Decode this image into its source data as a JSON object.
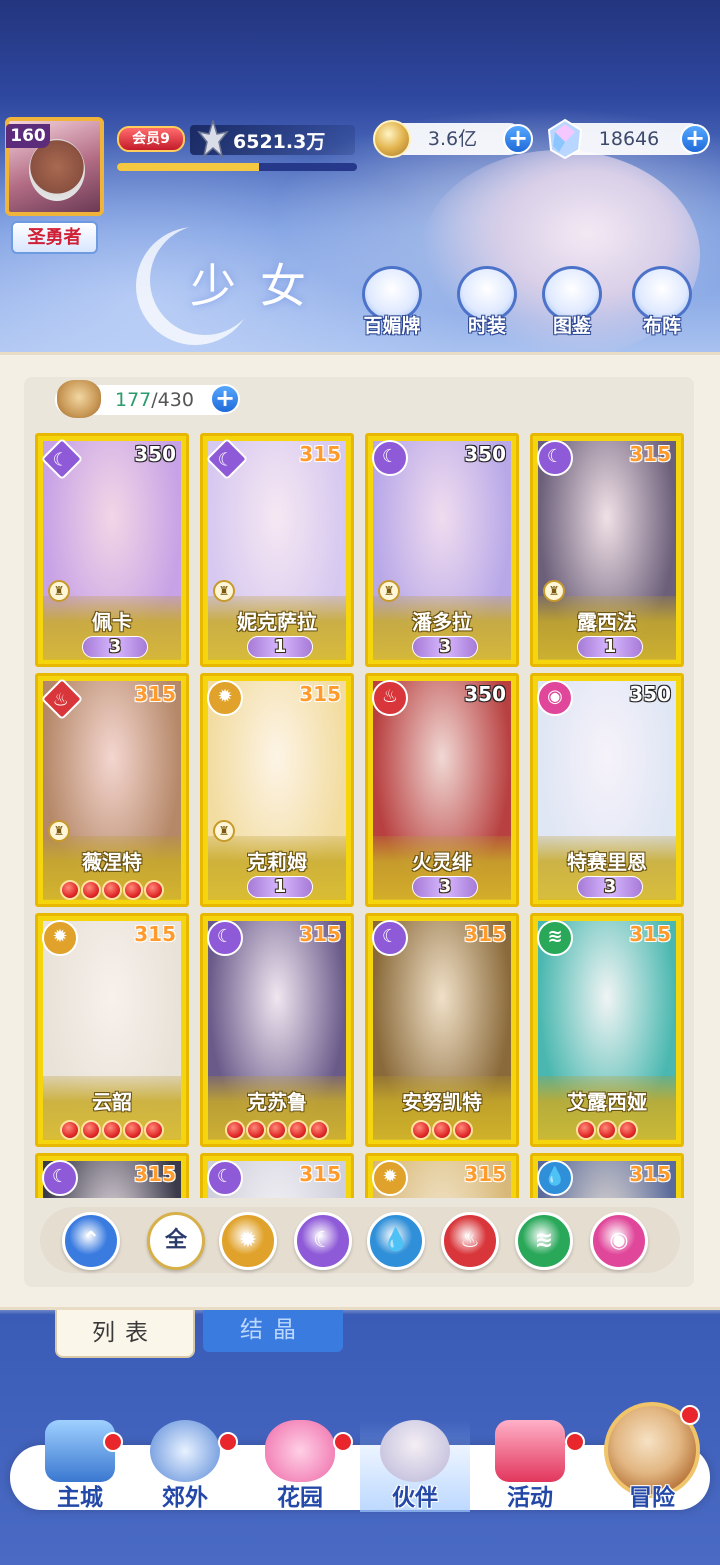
{
  "player": {
    "level": "160",
    "title": "圣勇者",
    "vip": "会员9",
    "power": "6521.3万",
    "exp_fraction": 0.59
  },
  "resources": {
    "gold": "3.6亿",
    "gems": "18646"
  },
  "page": {
    "title": "少女",
    "buttons": [
      "百媚牌",
      "时装",
      "图鉴",
      "布阵"
    ]
  },
  "roster": {
    "current": "177",
    "max": "/430"
  },
  "cards": [
    {
      "name": "佩卡",
      "level": "350",
      "element": "moon",
      "elem_shape": "diamond",
      "role": "rook",
      "wings": "3"
    },
    {
      "name": "妮克萨拉",
      "level": "315",
      "element": "moon",
      "elem_shape": "diamond",
      "role": "rook",
      "wings": "1"
    },
    {
      "name": "潘多拉",
      "level": "350",
      "element": "moon",
      "elem_shape": "circle",
      "role": "rook",
      "wings": "3"
    },
    {
      "name": "露西法",
      "level": "315",
      "element": "moon",
      "elem_shape": "circle",
      "role": "rook",
      "wings": "1"
    },
    {
      "name": "薇涅特",
      "level": "315",
      "element": "fire",
      "elem_shape": "diamond",
      "role": "rook",
      "stars": 5
    },
    {
      "name": "克莉姆",
      "level": "315",
      "element": "sun",
      "elem_shape": "circle",
      "role": "rook",
      "wings": "1"
    },
    {
      "name": "火灵绯",
      "level": "350",
      "element": "fire",
      "elem_shape": "circle",
      "wings": "3"
    },
    {
      "name": "特赛里恩",
      "level": "350",
      "element": "pink",
      "elem_shape": "circle",
      "wings": "3"
    },
    {
      "name": "云韶",
      "level": "315",
      "element": "sun",
      "elem_shape": "circle",
      "stars": 5
    },
    {
      "name": "克苏鲁",
      "level": "315",
      "element": "moon",
      "elem_shape": "circle",
      "stars": 5
    },
    {
      "name": "安努凯特",
      "level": "315",
      "element": "moon",
      "elem_shape": "circle",
      "stars": 3
    },
    {
      "name": "艾露西娅",
      "level": "315",
      "element": "wind",
      "elem_shape": "circle",
      "stars": 3
    },
    {
      "name": "",
      "level": "315",
      "element": "moon",
      "elem_shape": "circle"
    },
    {
      "name": "",
      "level": "315",
      "element": "moon",
      "elem_shape": "circle"
    },
    {
      "name": "",
      "level": "315",
      "element": "sun",
      "elem_shape": "circle"
    },
    {
      "name": "",
      "level": "315",
      "element": "water",
      "elem_shape": "circle"
    }
  ],
  "filters": {
    "all_label": "全",
    "items": [
      "sort",
      "all",
      "sun",
      "moon",
      "water",
      "fire",
      "wind",
      "pink"
    ]
  },
  "tabs": [
    "列表",
    "结晶"
  ],
  "nav": [
    "主城",
    "郊外",
    "花园",
    "伙伴",
    "活动",
    "冒险"
  ],
  "colors": {
    "moon": "#8e5ad8",
    "sun": "#e0a22a",
    "fire": "#d8363a",
    "water": "#2f8fd8",
    "wind": "#2aa85a",
    "pink": "#e0479a",
    "sort": "#3a7be0"
  }
}
